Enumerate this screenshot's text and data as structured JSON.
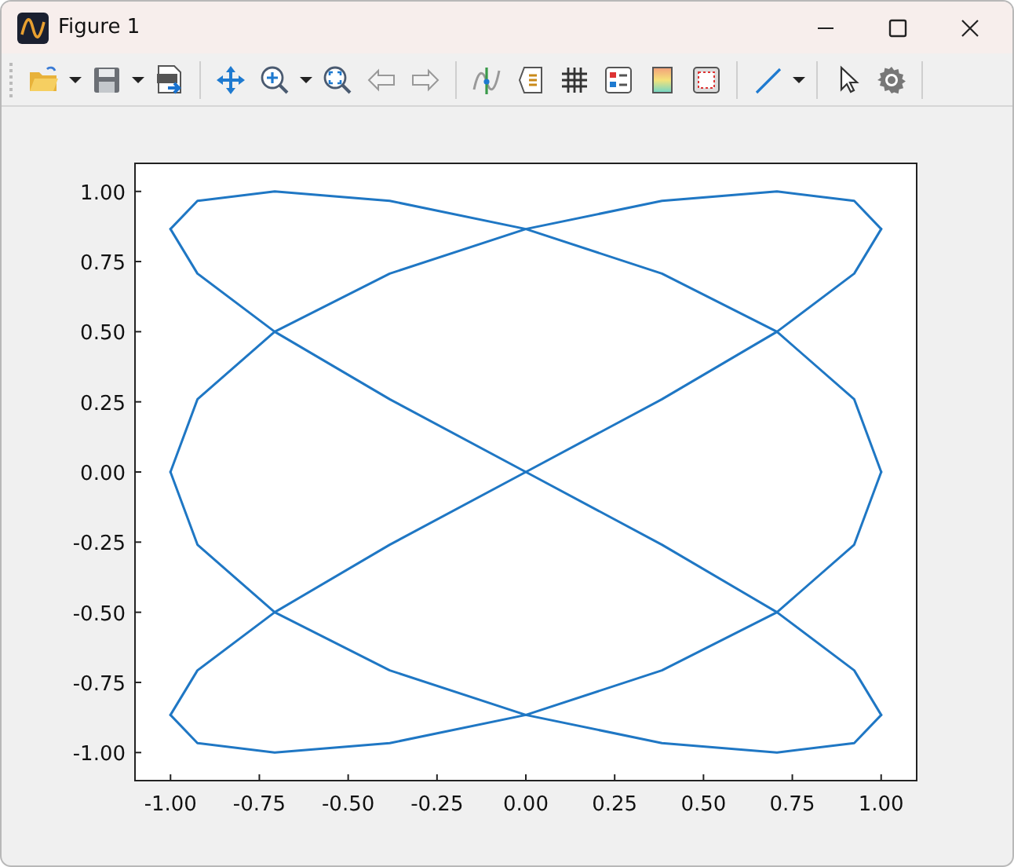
{
  "window": {
    "title": "Figure 1"
  },
  "plot": {
    "chart_data": {
      "type": "line",
      "xlim": [
        -1.1,
        1.1
      ],
      "ylim": [
        -1.1,
        1.1
      ],
      "xticks": [
        {
          "value": -1,
          "label": "-1.00"
        },
        {
          "value": -0.75,
          "label": "-0.75"
        },
        {
          "value": -0.5,
          "label": "-0.50"
        },
        {
          "value": -0.25,
          "label": "-0.25"
        },
        {
          "value": 0,
          "label": "0.00"
        },
        {
          "value": 0.25,
          "label": "0.25"
        },
        {
          "value": 0.5,
          "label": "0.50"
        },
        {
          "value": 0.75,
          "label": "0.75"
        },
        {
          "value": 1,
          "label": "1.00"
        }
      ],
      "yticks": [
        {
          "value": -1,
          "label": "-1.00"
        },
        {
          "value": -0.75,
          "label": "-0.75"
        },
        {
          "value": -0.5,
          "label": "-0.50"
        },
        {
          "value": -0.25,
          "label": "-0.25"
        },
        {
          "value": 0,
          "label": "0.00"
        },
        {
          "value": 0.25,
          "label": "0.25"
        },
        {
          "value": 0.5,
          "label": "0.50"
        },
        {
          "value": 0.75,
          "label": "0.75"
        },
        {
          "value": 1,
          "label": "1.00"
        }
      ],
      "x": [
        -1,
        -0.924,
        -0.707,
        -0.383,
        0,
        0.383,
        0.707,
        0.924,
        1
      ],
      "series": [
        {
          "color": "#1f77c4",
          "values": [
            0.866,
            0.966,
            1,
            0.966,
            0.866,
            0.707,
            0.5,
            0.259,
            0
          ]
        },
        {
          "color": "#1f77c4",
          "values": [
            0.866,
            0.707,
            0.5,
            0.259,
            0,
            -0.259,
            -0.5,
            -0.707,
            -0.866
          ]
        },
        {
          "color": "#1f77c4",
          "values": [
            0,
            -0.259,
            -0.5,
            -0.707,
            -0.866,
            -0.966,
            -1,
            -0.966,
            -0.866
          ]
        },
        {
          "color": "#1f77c4",
          "values": [
            0,
            0.259,
            0.5,
            0.707,
            0.866,
            0.966,
            1,
            0.966,
            0.866
          ]
        },
        {
          "color": "#1f77c4",
          "values": [
            -0.866,
            -0.707,
            -0.5,
            -0.259,
            0,
            0.259,
            0.5,
            0.707,
            0.866
          ]
        },
        {
          "color": "#1f77c4",
          "values": [
            -0.866,
            -0.966,
            -1,
            -0.966,
            -0.866,
            -0.707,
            -0.5,
            -0.259,
            0
          ]
        }
      ]
    }
  }
}
